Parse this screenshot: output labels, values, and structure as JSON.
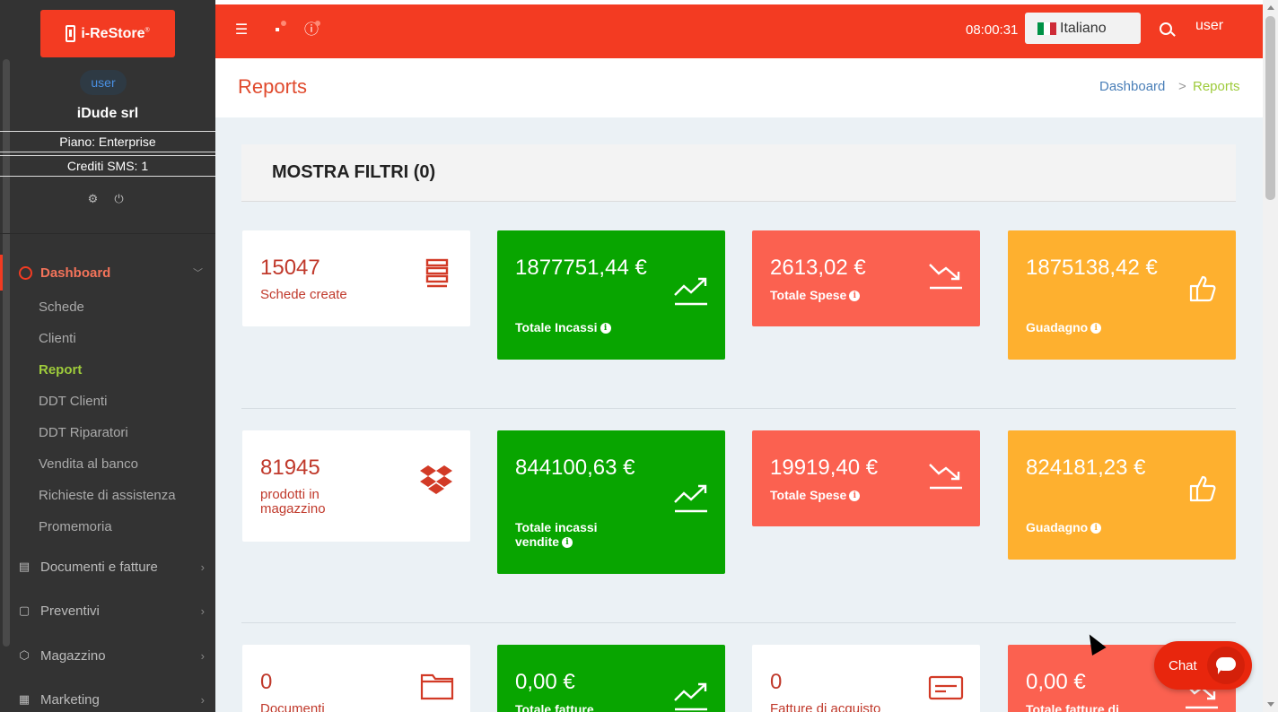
{
  "sidebar": {
    "logo_text": "i-ReStore",
    "logo_sup": "®",
    "avatar_alt": "user",
    "company": "iDude srl",
    "plan": "Piano: Enterprise",
    "sms_credits": "Crediti SMS: 1",
    "icons": [
      "gear-icon",
      "power-icon"
    ],
    "dashboard": {
      "label": "Dashboard",
      "icon": "dashboard-gauge-icon"
    },
    "sub_items": [
      {
        "label": "Schede",
        "active": false
      },
      {
        "label": "Clienti",
        "active": false
      },
      {
        "label": "Report",
        "active": true
      },
      {
        "label": "DDT Clienti",
        "active": false
      },
      {
        "label": "DDT Riparatori",
        "active": false
      },
      {
        "label": "Vendita al banco",
        "active": false
      },
      {
        "label": "Richieste di assistenza",
        "active": false
      },
      {
        "label": "Promemoria",
        "active": false
      }
    ],
    "nav_items": [
      {
        "label": "Documenti e fatture",
        "icon": "document-icon"
      },
      {
        "label": "Preventivi",
        "icon": "clipboard-icon"
      },
      {
        "label": "Magazzino",
        "icon": "box-icon"
      },
      {
        "label": "Marketing",
        "icon": "newspaper-icon"
      }
    ]
  },
  "topbar": {
    "time": "08:00:31",
    "language": "Italiano",
    "user": "user",
    "icons": [
      "menu-icon",
      "chat-icon",
      "info-icon",
      "search-icon"
    ]
  },
  "header": {
    "title": "Reports",
    "breadcrumb": [
      "Dashboard",
      "Reports"
    ],
    "separator": ">"
  },
  "filters": {
    "label": "MOSTRA FILTRI (0)"
  },
  "rows": [
    {
      "cards": [
        {
          "value": "15047",
          "label": "Schede create",
          "icon": "list-icon",
          "info": false
        },
        {
          "value": "1877751,44 €",
          "label": "Totale Incassi",
          "icon": "trend-up-icon",
          "info": true
        },
        {
          "value": "2613,02 €",
          "label": "Totale Spese",
          "icon": "trend-down-icon",
          "info": true
        },
        {
          "value": "1875138,42 €",
          "label": "Guadagno",
          "icon": "thumbs-up-icon",
          "info": true
        }
      ]
    },
    {
      "cards": [
        {
          "value": "81945",
          "label": "prodotti in magazzino",
          "icon": "dropbox-icon",
          "info": false
        },
        {
          "value": "844100,63 €",
          "label": "Totale incassi vendite",
          "icon": "trend-up-icon",
          "info": true
        },
        {
          "value": "19919,40 €",
          "label": "Totale Spese",
          "icon": "trend-down-icon",
          "info": true
        },
        {
          "value": "824181,23 €",
          "label": "Guadagno",
          "icon": "thumbs-up-icon",
          "info": true
        }
      ]
    },
    {
      "cards": [
        {
          "value": "0",
          "label": "Documenti",
          "icon": "folder-icon",
          "info": false
        },
        {
          "value": "0,00 €",
          "label": "Totale fatture",
          "icon": "trend-up-icon",
          "info": false
        },
        {
          "value": "0",
          "label": "Fatture di acquisto",
          "icon": "invoice-icon",
          "info": false
        },
        {
          "value": "0,00 €",
          "label": "Totale fatture di",
          "icon": "trend-down-icon",
          "info": false
        }
      ]
    }
  ],
  "chat": {
    "label": "Chat",
    "icon": "chat-bubble-icon"
  },
  "colors": {
    "brand": "#f33b22",
    "green": "#08a500",
    "red": "#fb6150",
    "yellow": "#feb02f",
    "sidebar_bg": "#333333",
    "active_link": "#9ecb3b",
    "breadcrumb_link": "#4a7fb8"
  }
}
